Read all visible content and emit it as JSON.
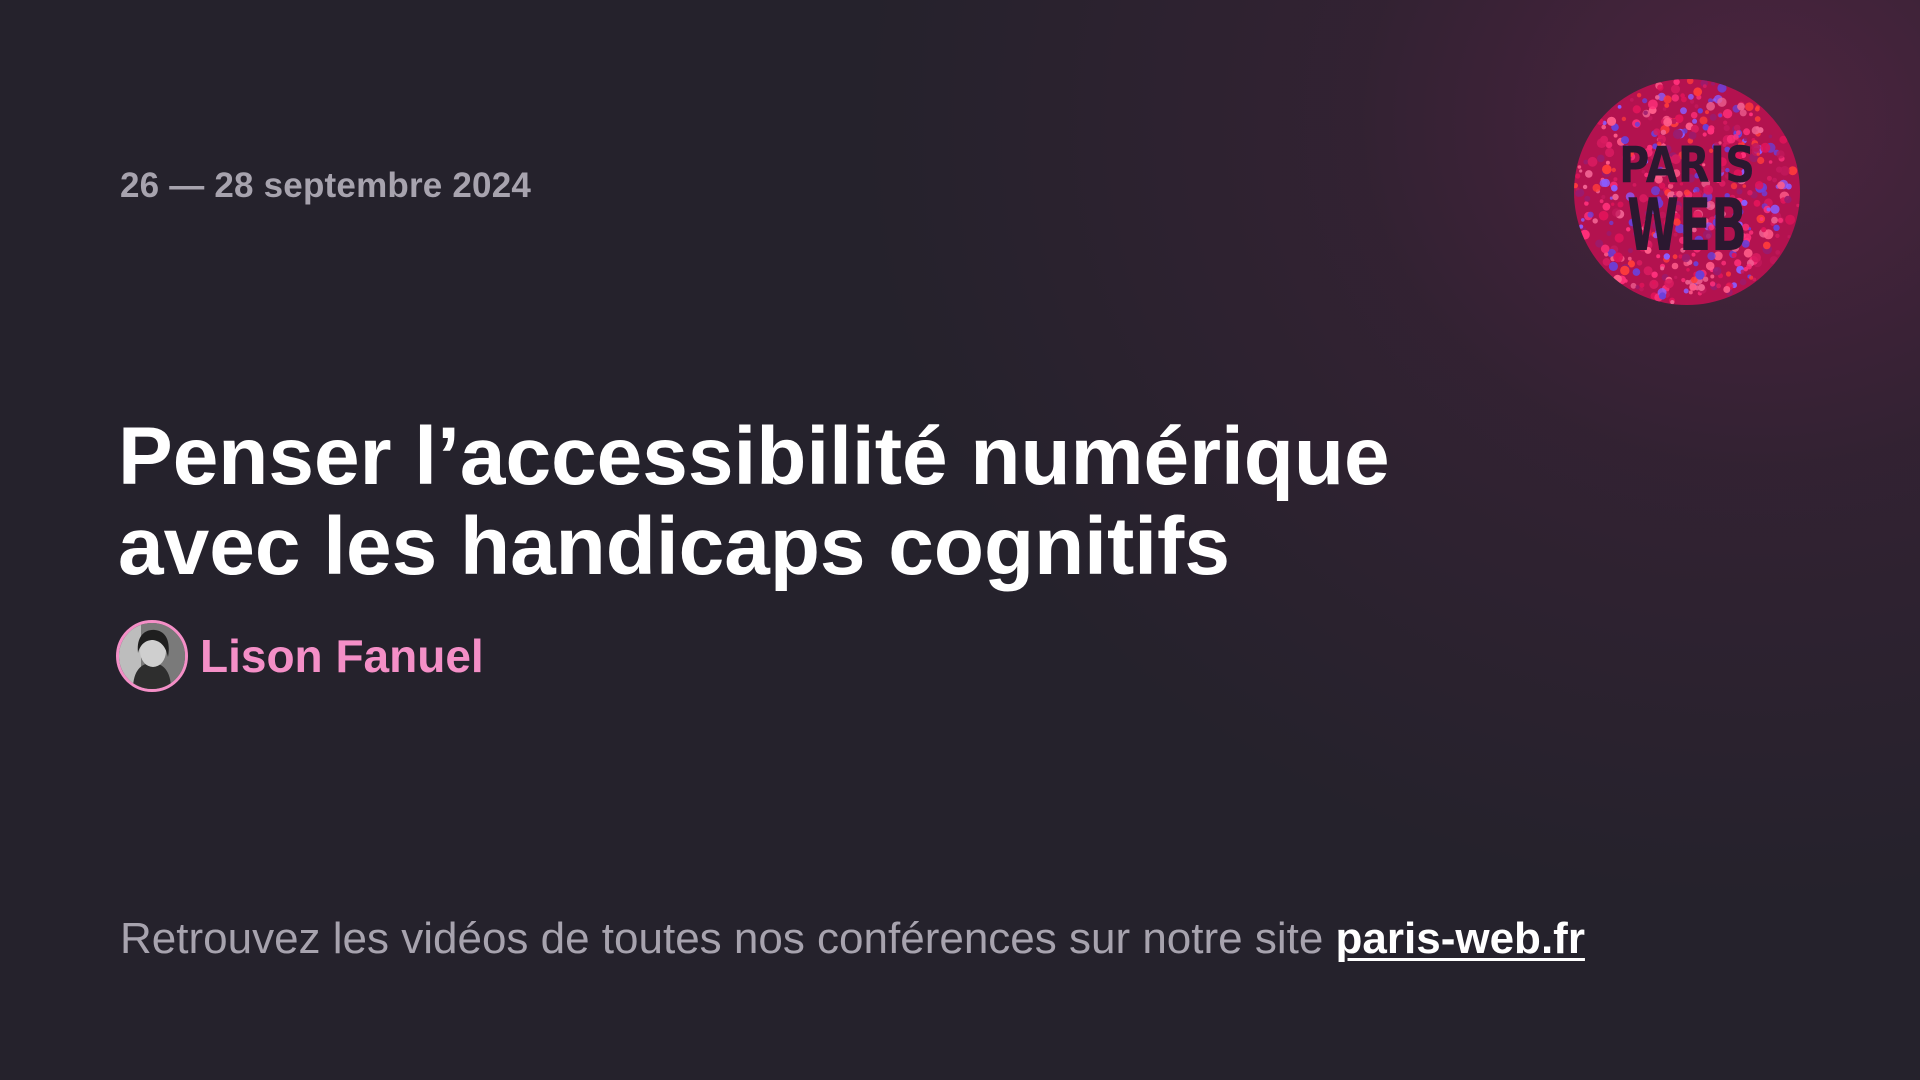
{
  "event": {
    "dates": "26 — 28 septembre 2024",
    "logo_text": [
      "PARIS",
      "WEB"
    ]
  },
  "talk": {
    "title_line1": "Penser l’accessibilité numérique",
    "title_line2": "avec les handicaps cognitifs",
    "speaker_name": "Lison Fanuel"
  },
  "footer": {
    "text": "Retrouvez les vidéos de toutes nos conférences sur notre site ",
    "link_label": "paris-web.fr"
  },
  "colors": {
    "background": "#25222c",
    "accent_pink": "#f48fc7",
    "muted_text": "#a7a3ae",
    "title_text": "#ffffff"
  },
  "icons": {
    "logo": "paris-web-dotted-circle-logo",
    "avatar": "speaker-avatar-photo"
  }
}
